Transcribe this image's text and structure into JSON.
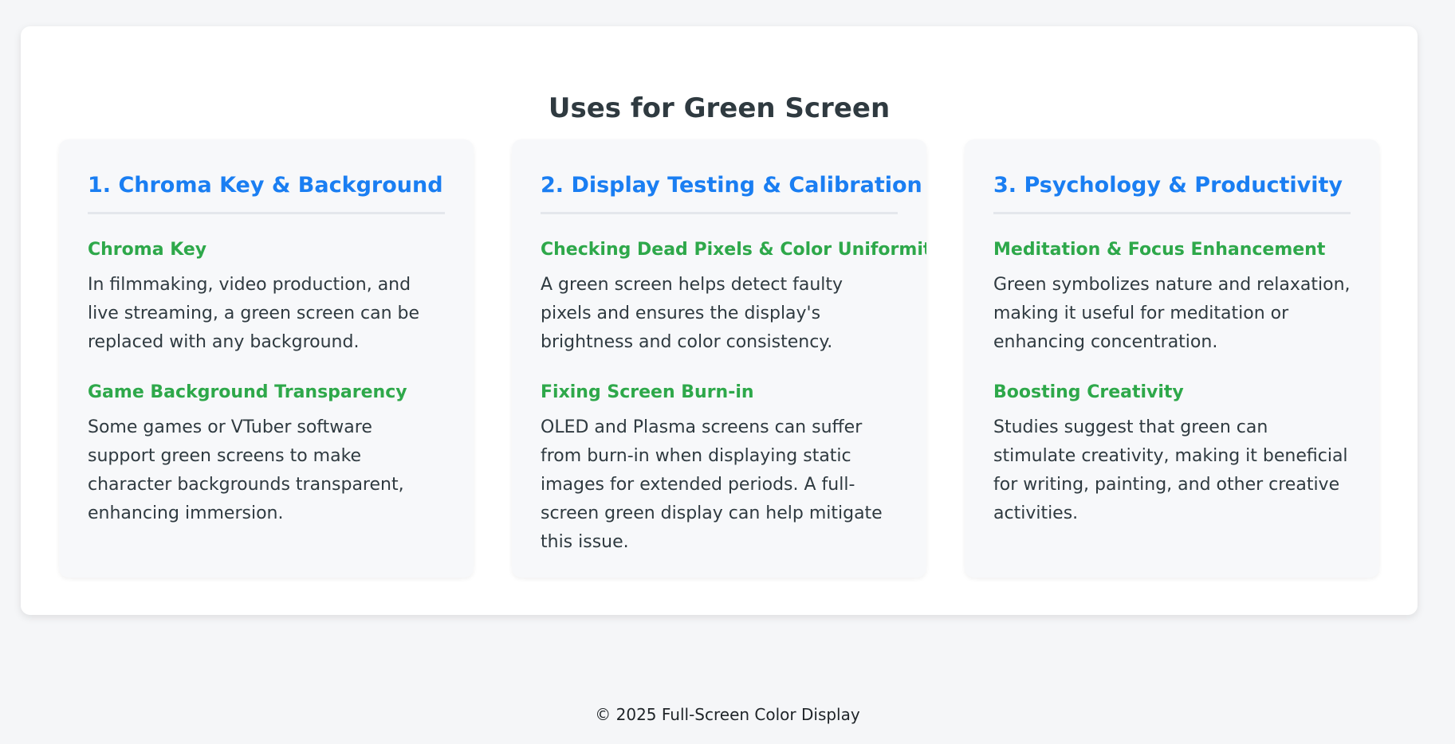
{
  "page": {
    "title": "Uses for Green Screen"
  },
  "colors": {
    "background": "#f5f6f8",
    "card": "#ffffff",
    "heading_blue": "#1a7ef2",
    "heading_green": "#2ea84a",
    "text": "#2f3a40"
  },
  "sections": [
    {
      "title": "1. Chroma Key & Background",
      "items": [
        {
          "title": "Chroma Key",
          "text": "In filmmaking, video production, and live streaming, a green screen can be replaced with any background."
        },
        {
          "title": "Game Background Transparency",
          "text": "Some games or VTuber software support green screens to make character backgrounds transparent, enhancing immersion."
        }
      ]
    },
    {
      "title": "2. Display Testing & Calibration",
      "items": [
        {
          "title": "Checking Dead Pixels & Color Uniformity",
          "text": "A green screen helps detect faulty pixels and ensures the display's brightness and color consistency."
        },
        {
          "title": "Fixing Screen Burn-in",
          "text": "OLED and Plasma screens can suffer from burn-in when displaying static images for extended periods. A full-screen green display can help mitigate this issue."
        }
      ]
    },
    {
      "title": "3. Psychology & Productivity",
      "items": [
        {
          "title": "Meditation & Focus Enhancement",
          "text": "Green symbolizes nature and relaxation, making it useful for meditation or enhancing concentration."
        },
        {
          "title": "Boosting Creativity",
          "text": "Studies suggest that green can stimulate creativity, making it beneficial for writing, painting, and other creative activities."
        }
      ]
    }
  ],
  "footer": {
    "text": "© 2025 Full-Screen Color Display"
  }
}
